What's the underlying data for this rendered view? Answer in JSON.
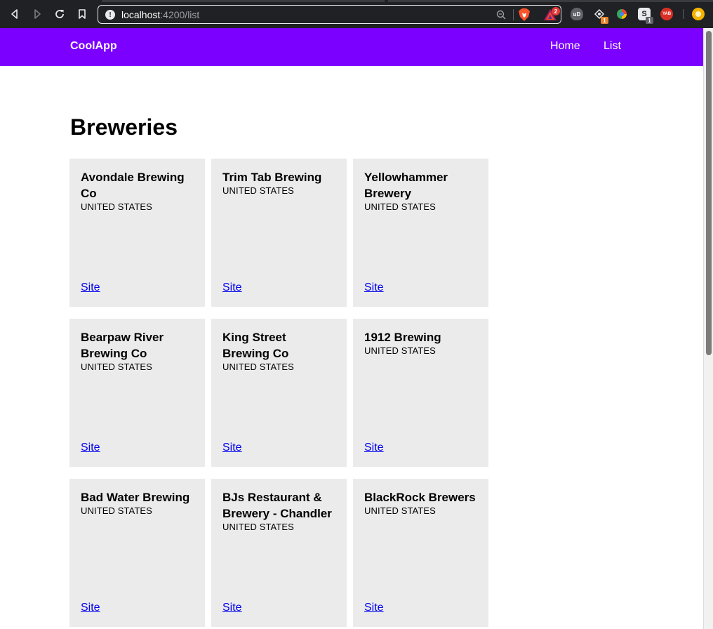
{
  "browser": {
    "url_host": "localhost",
    "url_rest": ":4200/list",
    "rewards_badge": "2",
    "ext_badge_1": "1",
    "ext_badge_2": "1",
    "ext_yab_label": "YAB",
    "ext_s_label": "S",
    "ext_ub_label": "uD"
  },
  "nav": {
    "brand": "CoolApp",
    "links": [
      {
        "label": "Home"
      },
      {
        "label": "List"
      }
    ],
    "color": "#7b00ff"
  },
  "page": {
    "title": "Breweries"
  },
  "breweries": [
    {
      "name": "Avondale Brewing Co",
      "country": "UNITED STATES",
      "link": "Site"
    },
    {
      "name": "Trim Tab Brewing",
      "country": "UNITED STATES",
      "link": "Site"
    },
    {
      "name": "Yellowhammer Brewery",
      "country": "UNITED STATES",
      "link": "Site"
    },
    {
      "name": "Bearpaw River Brewing Co",
      "country": "UNITED STATES",
      "link": "Site"
    },
    {
      "name": "King Street Brewing Co",
      "country": "UNITED STATES",
      "link": "Site"
    },
    {
      "name": "1912 Brewing",
      "country": "UNITED STATES",
      "link": "Site"
    },
    {
      "name": "Bad Water Brewing",
      "country": "UNITED STATES",
      "link": "Site"
    },
    {
      "name": "BJs Restaurant & Brewery - Chandler",
      "country": "UNITED STATES",
      "link": "Site"
    },
    {
      "name": "BlackRock Brewers",
      "country": "UNITED STATES",
      "link": "Site"
    }
  ]
}
